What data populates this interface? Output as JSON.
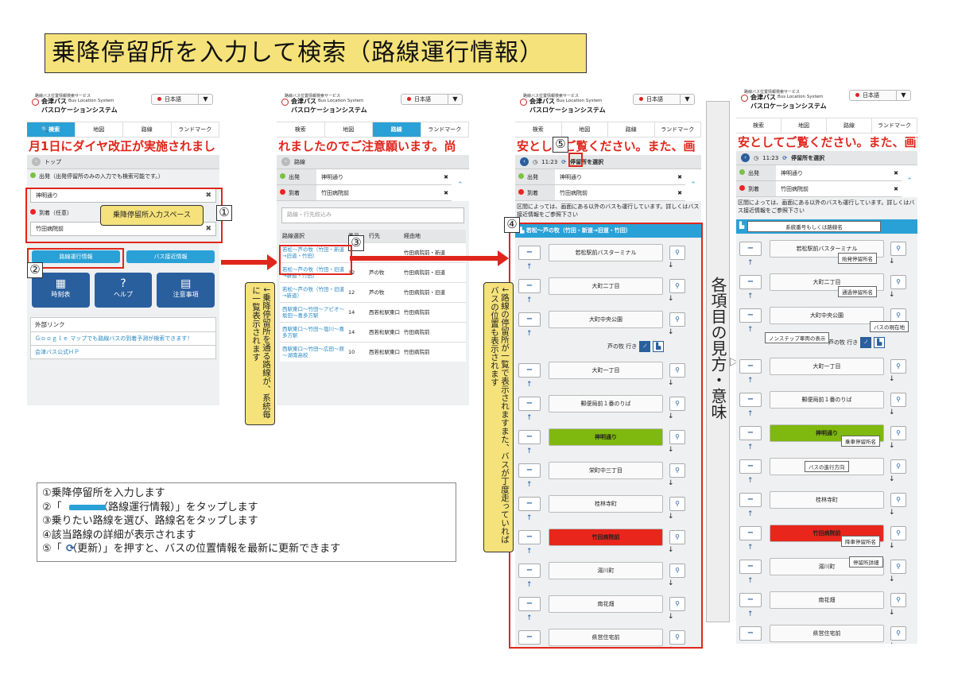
{
  "title": "乗降停留所を入力して検索（路線運行情報）",
  "common": {
    "service": "路線バス位置情報検索サービス",
    "brand": "会津バス",
    "system_en": "Bus Location System",
    "system_jp": "バスロケーションシステム",
    "language": "日本語",
    "tabs": [
      "検索",
      "地図",
      "路線",
      "ランドマーク"
    ]
  },
  "screen1": {
    "ticker": "月1日にダイヤ改正が実施されまし",
    "breadcrumb": "トップ",
    "departure_hint": "出発（出発停留所のみの入力でも検索可能です。）",
    "departure_value": "神明通り",
    "arrival_label": "到着（任意）",
    "arrival_value": "竹田病院前",
    "callout": "乗降停留所入力スペース",
    "btn_route_info": "路線運行情報",
    "btn_approach": "バス接近情報",
    "btn_timetable": "時刻表",
    "btn_help": "ヘルプ",
    "btn_notes": "注意事項",
    "external_header": "外部リンク",
    "link_google": "Ｇｏｏｇｌｅ マップでも路線バスの到着予測が検索できます！",
    "link_official": "会津バス公式ＨＰ"
  },
  "screen2": {
    "ticker": "れましたのでご注意願います。尚",
    "breadcrumb": "路線",
    "departure_label": "出発",
    "departure_value": "神明通り",
    "arrival_label": "到着",
    "arrival_value": "竹田病院前",
    "filter_placeholder": "路線・行先絞込み",
    "col_route": "路線選択",
    "col_num": "番号",
    "col_dest": "行先",
    "col_via": "経由地",
    "rows": [
      {
        "route": "若松～芦の牧（竹田・新道→旧道・竹田）",
        "num": "",
        "dest": "",
        "via": "竹田病院前・新道"
      },
      {
        "route": "若松～芦の牧（竹田・旧道→新道・竹田）",
        "num": "12",
        "dest": "芦の牧",
        "via": "竹田病院前・旧道"
      },
      {
        "route": "若松～芦の牧（竹田・旧道→新道）",
        "num": "12",
        "dest": "芦の牧",
        "via": "竹田病院前・旧道"
      },
      {
        "route": "西駅東口～竹田～アピオ～坂田～喜多方駅",
        "num": "14",
        "dest": "西若松駅東口",
        "via": "竹田病院前"
      },
      {
        "route": "西駅東口～竹田～塩川～喜多方駅",
        "num": "14",
        "dest": "西若松駅東口",
        "via": "竹田病院前"
      },
      {
        "route": "西駅東口～竹田～広田～原～湖南高校",
        "num": "10",
        "dest": "西若松駅東口",
        "via": "竹田病院前"
      }
    ],
    "side_note": "↓乗降停留所を通る路線が、系統毎に一覧表示されます"
  },
  "screen3": {
    "ticker": "安としてご覧ください。また、画",
    "time": "11:23",
    "select_stop": "停留所を選択",
    "departure_label": "出発",
    "departure_value": "神明通り",
    "arrival_label": "到着",
    "arrival_value": "竹田病院前",
    "notice": "区間によっては、画面にある以外のバスも運行しています。詳しくはバス接近情報をご参照下さい",
    "route_header": "若松～芦の牧（竹田・新道→旧道・竹田）",
    "bus_dest": "芦の牧 行き",
    "stops": [
      "若松駅前バスターミナル",
      "大町二丁目",
      "大町中央公園",
      "大町一丁目",
      "郵便局前１番のりば",
      "神明通り",
      "栄町中三丁目",
      "桂林寺町",
      "竹田病院前",
      "湯川町",
      "南花畑",
      "県営住宅前"
    ],
    "side_note": "↓路線の停留所が一覧で表示されますまた、バスが丁度走っていればバスの位置も表示されます"
  },
  "screen4": {
    "ticker": "安としてご覧ください。また、画面",
    "time": "11:23",
    "select_stop": "停留所を選択",
    "departure_label": "出発",
    "departure_value": "神明通り",
    "arrival_label": "到着",
    "arrival_value": "竹田病院前",
    "notice": "区間によっては、画面にある以外のバスも運行しています。詳しくはバス接近情報をご参照下さい",
    "header_label": "系統番号もしくは路線名",
    "bus_dest": "芦の牧 行き",
    "stops": [
      "若松駅前バスターミナル",
      "大町二丁目",
      "大町中央公園",
      "大町一丁目",
      "郵便局前１番のりば",
      "神明通り",
      "栄町中三丁目",
      "桂林寺町",
      "竹田病院前",
      "湯川町",
      "南花畑",
      "県営住宅前"
    ],
    "lbl_origin": "始発停留所名",
    "lbl_transit": "通過停留所名",
    "lbl_nonstep": "ノンステップ車両の表示",
    "lbl_bus_pos": "バスの現在地",
    "lbl_boarding": "乗車停留所名",
    "lbl_direction": "バスの進行方向",
    "lbl_alighting": "降車停留所名",
    "lbl_detail": "停留所詳細"
  },
  "legend_side": "各項目の見方・意味",
  "steps": [
    "①乗降停留所を入力します",
    "②「　　　　（路線運行情報）」をタップします",
    "③乗りたい路線を選び、路線名をタップします",
    "④該当路線の詳細が表示されます",
    "⑤「　（更新）」を押すと、バスの位置情報を最新に更新できます"
  ],
  "markers": [
    "①",
    "②",
    "③",
    "④",
    "⑤"
  ],
  "colors": {
    "accent": "#2aa1d6",
    "navy": "#2a5f9e",
    "ticker": "#e0261c",
    "boarding": "#7fb80e",
    "alighting": "#e8261c",
    "callout": "#f5e27a"
  }
}
